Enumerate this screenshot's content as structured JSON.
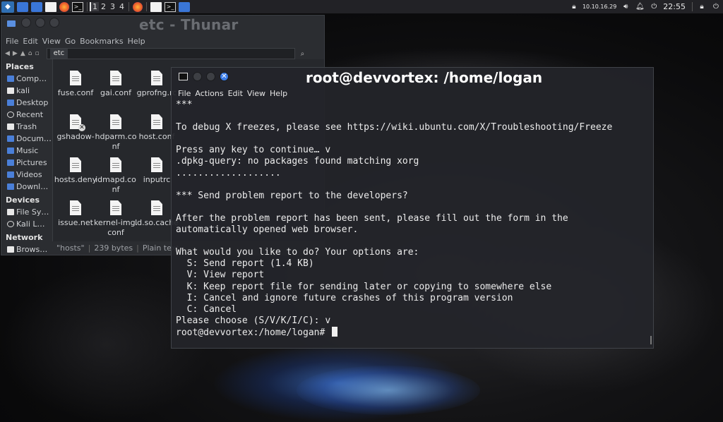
{
  "panel": {
    "workspaces": [
      "1",
      "2",
      "3",
      "4"
    ],
    "active_workspace": "1",
    "ip": "10.10.16.29",
    "clock": "22:55",
    "icons": [
      "kali-menu-icon",
      "blue-window-icon",
      "file-manager-icon",
      "text-file-icon",
      "firefox-icon",
      "terminal-icon",
      "firefox-task-icon",
      "document-task-icon",
      "terminal-task-icon",
      "window-task-icon",
      "lock-icon",
      "volume-icon",
      "notification-icon",
      "power-icon"
    ]
  },
  "thunar": {
    "title": "etc - Thunar",
    "menu": [
      "File",
      "Edit",
      "View",
      "Go",
      "Bookmarks",
      "Help"
    ],
    "path_tab": "etc",
    "sidebar": {
      "places_label": "Places",
      "places": [
        "Comp…",
        "kali",
        "Desktop",
        "Recent",
        "Trash",
        "Docum…",
        "Music",
        "Pictures",
        "Videos",
        "Downl…"
      ],
      "devices_label": "Devices",
      "devices": [
        "File Sy…",
        "Kali L…"
      ],
      "network_label": "Network",
      "network": [
        "Brows…"
      ]
    },
    "files": [
      "fuse.conf",
      "gai.conf",
      "gprofng.rc",
      "gshadow-",
      "hdparm.conf",
      "host.conf",
      "hosts.deny",
      "idmapd.conf",
      "inputrc",
      "issue.net",
      "kernel-img.conf",
      "ld.so.cache"
    ],
    "status": {
      "name": "\"hosts\"",
      "size": "239 bytes",
      "type": "Plain text"
    }
  },
  "terminal": {
    "title": "root@devvortex: /home/logan",
    "menu": [
      "File",
      "Actions",
      "Edit",
      "View",
      "Help"
    ],
    "lines": [
      "***",
      "",
      "To debug X freezes, please see https://wiki.ubuntu.com/X/Troubleshooting/Freeze",
      "",
      "Press any key to continue… v",
      ".dpkg-query: no packages found matching xorg",
      "...................",
      "",
      "*** Send problem report to the developers?",
      "",
      "After the problem report has been sent, please fill out the form in the",
      "automatically opened web browser.",
      "",
      "What would you like to do? Your options are:",
      "  S: Send report (1.4 KB)",
      "  V: View report",
      "  K: Keep report file for sending later or copying to somewhere else",
      "  I: Cancel and ignore future crashes of this program version",
      "  C: Cancel",
      "Please choose (S/V/K/I/C): v"
    ],
    "prompt": "root@devvortex:/home/logan# "
  }
}
